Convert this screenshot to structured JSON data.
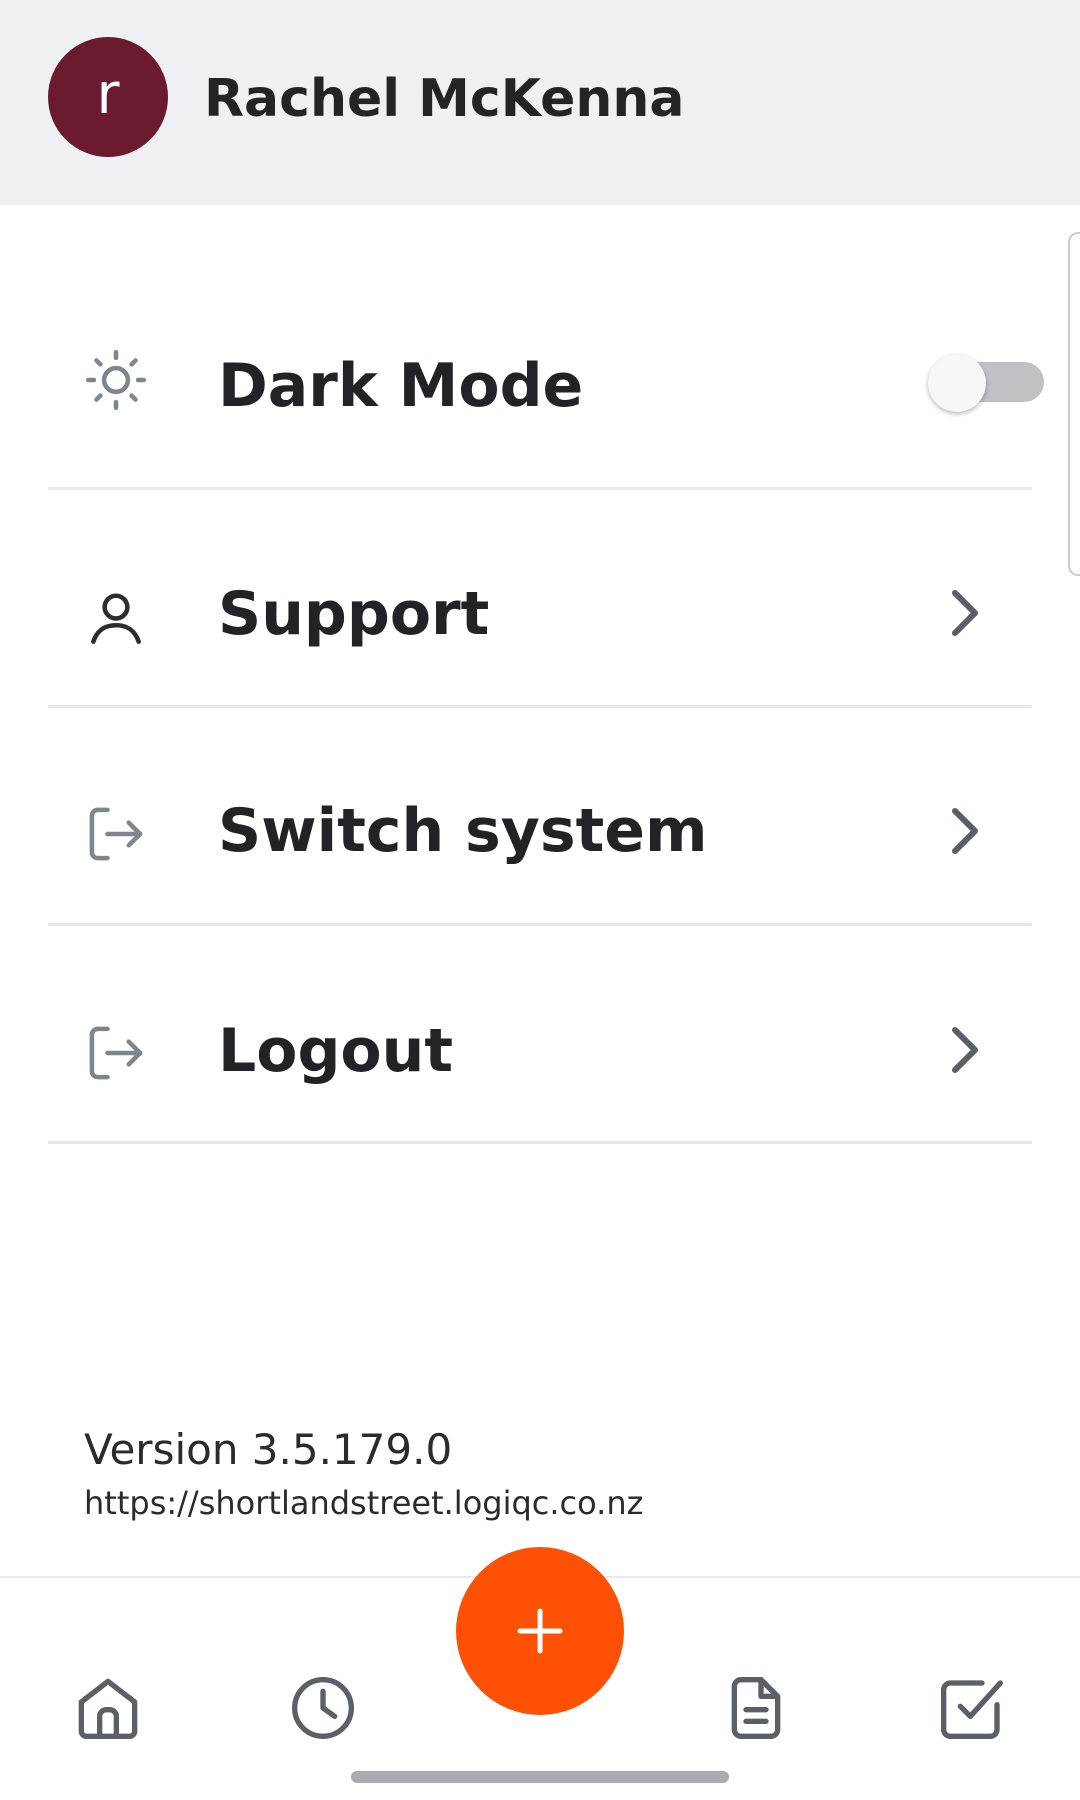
{
  "header": {
    "avatar_initial": "r",
    "avatar_color": "#6b1a2f",
    "user_name": "Rachel McKenna"
  },
  "menu": [
    {
      "label": "Dark Mode",
      "icon": "sun-icon",
      "control": "toggle",
      "toggle_on": false
    },
    {
      "label": "Support",
      "icon": "user-icon",
      "control": "chevron-right-icon"
    },
    {
      "label": "Switch system",
      "icon": "exit-arrow-icon",
      "control": "chevron-right-icon"
    },
    {
      "label": "Logout",
      "icon": "exit-arrow-icon",
      "control": "chevron-right-icon"
    }
  ],
  "footer": {
    "version": "Version 3.5.179.0",
    "url": "https://shortlandstreet.logiqc.co.nz"
  },
  "bottom_nav": {
    "items": [
      "home-icon",
      "clock-icon",
      "plus-icon",
      "document-icon",
      "checkbox-icon"
    ],
    "fab_color": "#fe5105"
  }
}
